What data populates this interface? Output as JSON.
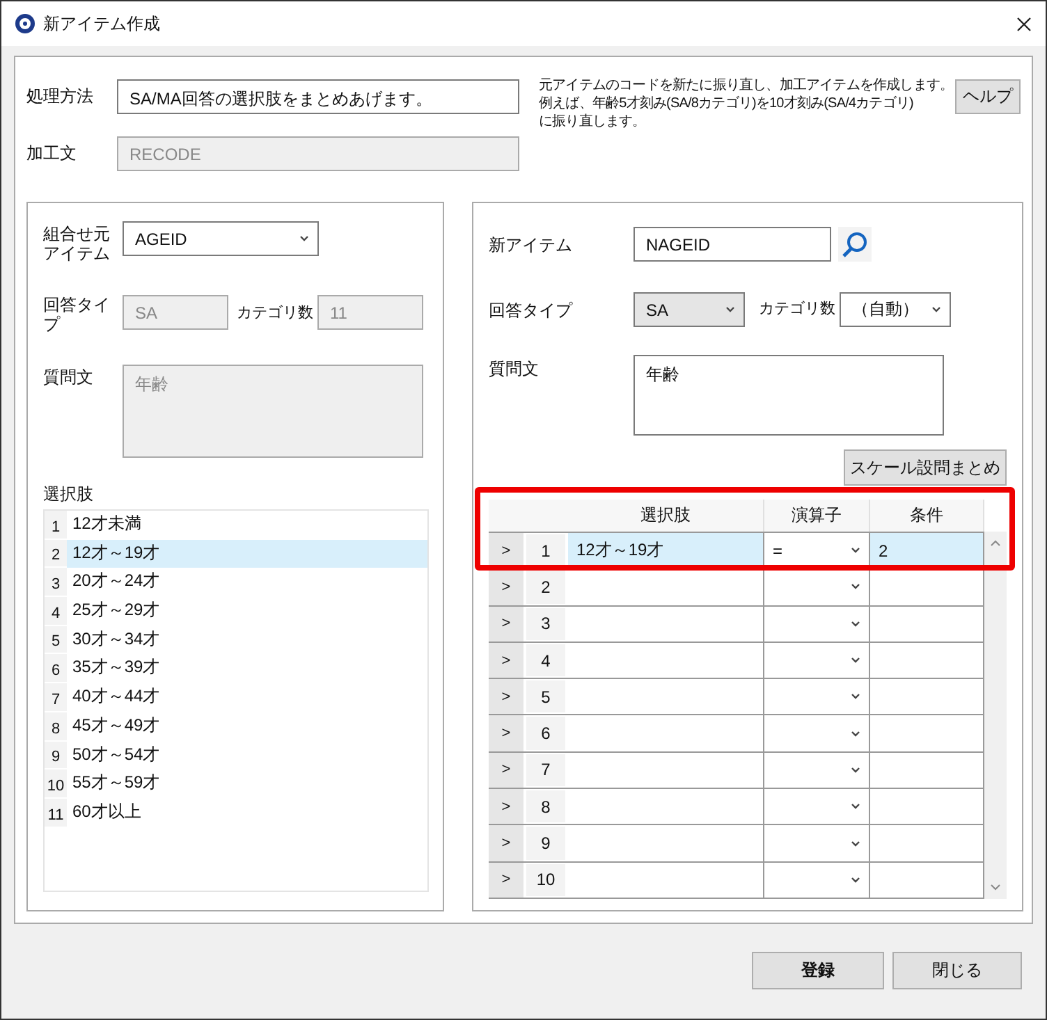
{
  "window": {
    "title": "新アイテム作成"
  },
  "method": {
    "label": "処理方法",
    "value": "SA/MA回答の選択肢をまとめあげます。"
  },
  "statement": {
    "label": "加工文",
    "value": "RECODE",
    "disabled": true
  },
  "description_lines": [
    "元アイテムのコードを新たに振り直し、加工アイテムを作成します。",
    "例えば、年齢5才刻み(SA/8カテゴリ)を10才刻み(SA/4カテゴリ)",
    "に振り直します。"
  ],
  "help_button": "ヘルプ",
  "source": {
    "item_label": "組合せ元アイテム",
    "item_value": "AGEID",
    "type_label": "回答タイプ",
    "type_value": "SA",
    "type_disabled": true,
    "count_label": "カテゴリ数",
    "count_value": "11",
    "count_disabled": true,
    "question_label": "質問文",
    "question_value": "年齢",
    "question_disabled": true,
    "choices_label": "選択肢",
    "choices": [
      {
        "number": "1",
        "text": "12才未満",
        "selected": false
      },
      {
        "number": "2",
        "text": "12才～19才",
        "selected": true
      },
      {
        "number": "3",
        "text": "20才～24才",
        "selected": false
      },
      {
        "number": "4",
        "text": "25才～29才",
        "selected": false
      },
      {
        "number": "5",
        "text": "30才～34才",
        "selected": false
      },
      {
        "number": "6",
        "text": "35才～39才",
        "selected": false
      },
      {
        "number": "7",
        "text": "40才～44才",
        "selected": false
      },
      {
        "number": "8",
        "text": "45才～49才",
        "selected": false
      },
      {
        "number": "9",
        "text": "50才～54才",
        "selected": false
      },
      {
        "number": "10",
        "text": "55才～59才",
        "selected": false
      },
      {
        "number": "11",
        "text": "60才以上",
        "selected": false
      }
    ]
  },
  "target": {
    "item_label": "新アイテム",
    "item_value": "NAGEID",
    "type_label": "回答タイプ",
    "type_value": "SA",
    "count_label": "カテゴリ数",
    "count_value": "（自動）",
    "question_label": "質問文",
    "question_value": "年齢",
    "scale_button": "スケール設問まとめ",
    "columns": [
      "選択肢",
      "演算子",
      "条件"
    ],
    "rows": [
      {
        "marker": ">",
        "number": "1",
        "choice": "12才～19才",
        "operator": "=",
        "condition": "2",
        "selected": true
      },
      {
        "marker": ">",
        "number": "2",
        "selected": false
      },
      {
        "marker": ">",
        "number": "3",
        "selected": false
      },
      {
        "marker": ">",
        "number": "4",
        "selected": false
      },
      {
        "marker": ">",
        "number": "5",
        "selected": false
      },
      {
        "marker": ">",
        "number": "6",
        "selected": false
      },
      {
        "marker": ">",
        "number": "7",
        "selected": false
      },
      {
        "marker": ">",
        "number": "8",
        "selected": false
      },
      {
        "marker": ">",
        "number": "9",
        "selected": false
      },
      {
        "marker": ">",
        "number": "10",
        "selected": false
      }
    ]
  },
  "buttons": [
    "登録",
    "閉じる"
  ]
}
